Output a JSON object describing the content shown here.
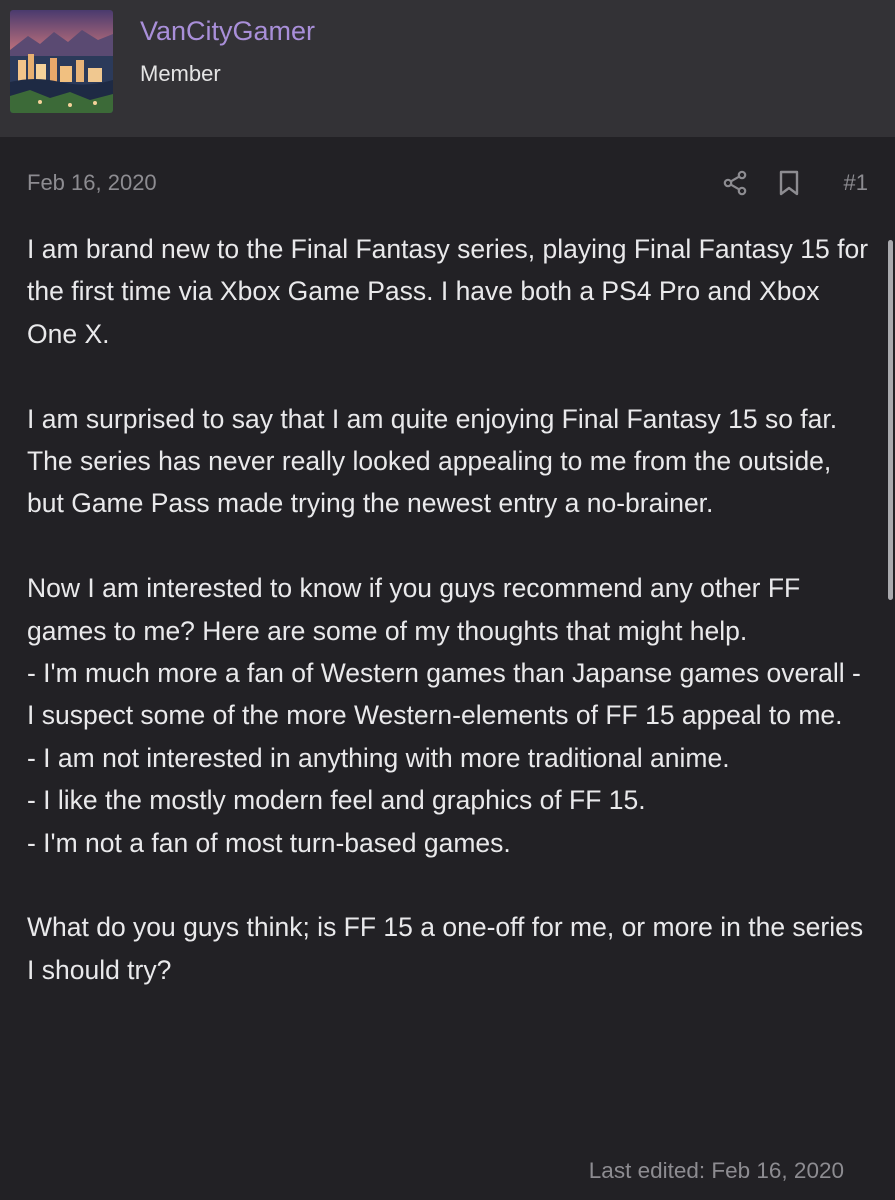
{
  "user": {
    "name": "VanCityGamer",
    "title": "Member",
    "avatar_icon": "city-skyline-avatar"
  },
  "post": {
    "date": "Feb 16, 2020",
    "number": "#1",
    "share_icon": "share-icon",
    "bookmark_icon": "bookmark-icon",
    "paragraphs": [
      "I am brand new to the Final Fantasy series, playing Final Fantasy 15 for the first time via Xbox Game Pass. I have both a PS4 Pro and Xbox One X.",
      "I am surprised to say that I am quite enjoying Final Fantasy 15 so far. The series has never really looked appealing to me from the outside, but Game Pass made trying the newest entry a no-brainer.",
      "Now I am interested to know if you guys recommend any other FF games to me? Here are some of my thoughts that might help.",
      "- I'm much more a fan of Western games than Japanse games overall - I suspect some of the more Western-elements of FF 15 appeal to me.",
      "- I am not interested in anything with more traditional anime.",
      "- I like the mostly modern feel and graphics of FF 15.",
      "- I'm not a fan of most turn-based games.",
      "What do you guys think; is FF 15 a one-off for me, or more in the series I should try?"
    ],
    "last_edited": "Last edited: Feb 16, 2020"
  },
  "colors": {
    "background": "#222125",
    "header_background": "#333236",
    "username": "#a98fd9",
    "body_text": "#e9e9eb",
    "muted_text": "#8d8c91"
  }
}
